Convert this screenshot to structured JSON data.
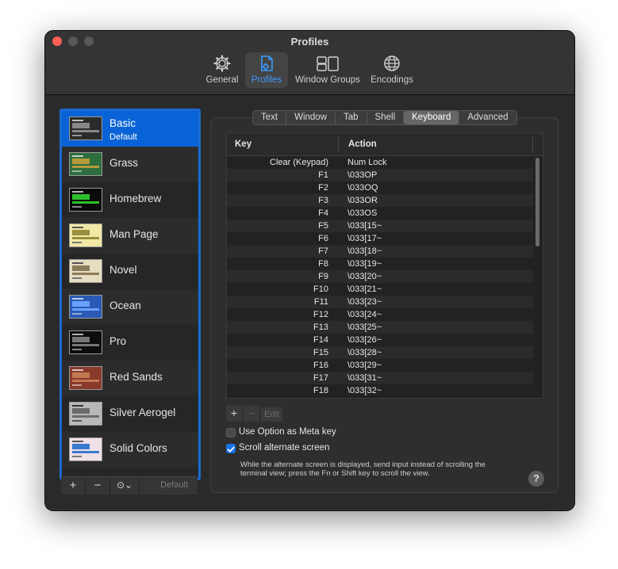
{
  "window": {
    "title": "Profiles"
  },
  "toolbar": {
    "items": [
      {
        "label": "General",
        "icon": "gear-icon"
      },
      {
        "label": "Profiles",
        "icon": "profiles-icon"
      },
      {
        "label": "Window Groups",
        "icon": "window-groups-icon"
      },
      {
        "label": "Encodings",
        "icon": "globe-icon"
      }
    ],
    "active": "Profiles"
  },
  "sidebar": {
    "profiles": [
      {
        "name": "Basic",
        "subtitle": "Default",
        "selected": true,
        "thumb_bg": "#2b2b2b",
        "thumb_hl": "#888888"
      },
      {
        "name": "Grass",
        "thumb_bg": "#2e6e3e",
        "thumb_hl": "#b59a3c"
      },
      {
        "name": "Homebrew",
        "thumb_bg": "#0a0a0a",
        "thumb_hl": "#2bbf2b"
      },
      {
        "name": "Man Page",
        "thumb_bg": "#f2e9a6",
        "thumb_hl": "#9b8e3c"
      },
      {
        "name": "Novel",
        "thumb_bg": "#e6dcc0",
        "thumb_hl": "#8c7b58"
      },
      {
        "name": "Ocean",
        "thumb_bg": "#2a5ab5",
        "thumb_hl": "#6aa0ff"
      },
      {
        "name": "Pro",
        "thumb_bg": "#0d0d0d",
        "thumb_hl": "#777777"
      },
      {
        "name": "Red Sands",
        "thumb_bg": "#8a3a2a",
        "thumb_hl": "#c07a50"
      },
      {
        "name": "Silver Aerogel",
        "thumb_bg": "#b8b8b8",
        "thumb_hl": "#6a6a6a"
      },
      {
        "name": "Solid Colors",
        "thumb_bg": "#f0e0e8",
        "thumb_hl": "#3a7ad0"
      }
    ],
    "bottom": {
      "add": "+",
      "remove": "−",
      "more": "⊙⌄",
      "default_label": "Default"
    }
  },
  "tabs": {
    "items": [
      "Text",
      "Window",
      "Tab",
      "Shell",
      "Keyboard",
      "Advanced"
    ],
    "active": "Keyboard"
  },
  "table": {
    "headers": {
      "key": "Key",
      "action": "Action"
    },
    "rows": [
      {
        "key": "Clear (Keypad)",
        "action": "Num Lock"
      },
      {
        "key": "F1",
        "action": "\\033OP"
      },
      {
        "key": "F2",
        "action": "\\033OQ"
      },
      {
        "key": "F3",
        "action": "\\033OR"
      },
      {
        "key": "F4",
        "action": "\\033OS"
      },
      {
        "key": "F5",
        "action": "\\033[15~"
      },
      {
        "key": "F6",
        "action": "\\033[17~"
      },
      {
        "key": "F7",
        "action": "\\033[18~"
      },
      {
        "key": "F8",
        "action": "\\033[19~"
      },
      {
        "key": "F9",
        "action": "\\033[20~"
      },
      {
        "key": "F10",
        "action": "\\033[21~"
      },
      {
        "key": "F11",
        "action": "\\033[23~"
      },
      {
        "key": "F12",
        "action": "\\033[24~"
      },
      {
        "key": "F13",
        "action": "\\033[25~"
      },
      {
        "key": "F14",
        "action": "\\033[26~"
      },
      {
        "key": "F15",
        "action": "\\033[28~"
      },
      {
        "key": "F16",
        "action": "\\033[29~"
      },
      {
        "key": "F17",
        "action": "\\033[31~"
      },
      {
        "key": "F18",
        "action": "\\033[32~"
      }
    ]
  },
  "table_buttons": {
    "add": "+",
    "remove": "−",
    "edit": "Edit"
  },
  "options": {
    "meta": {
      "label": "Use Option as Meta key",
      "checked": false
    },
    "scroll": {
      "label": "Scroll alternate screen",
      "checked": true
    },
    "note": "While the alternate screen is displayed, send input instead of scrolling the terminal view; press the Fn or Shift key to scroll the view."
  },
  "help": {
    "label": "?"
  },
  "colors": {
    "accent": "#1a73e8",
    "selection": "#0a63d6"
  }
}
